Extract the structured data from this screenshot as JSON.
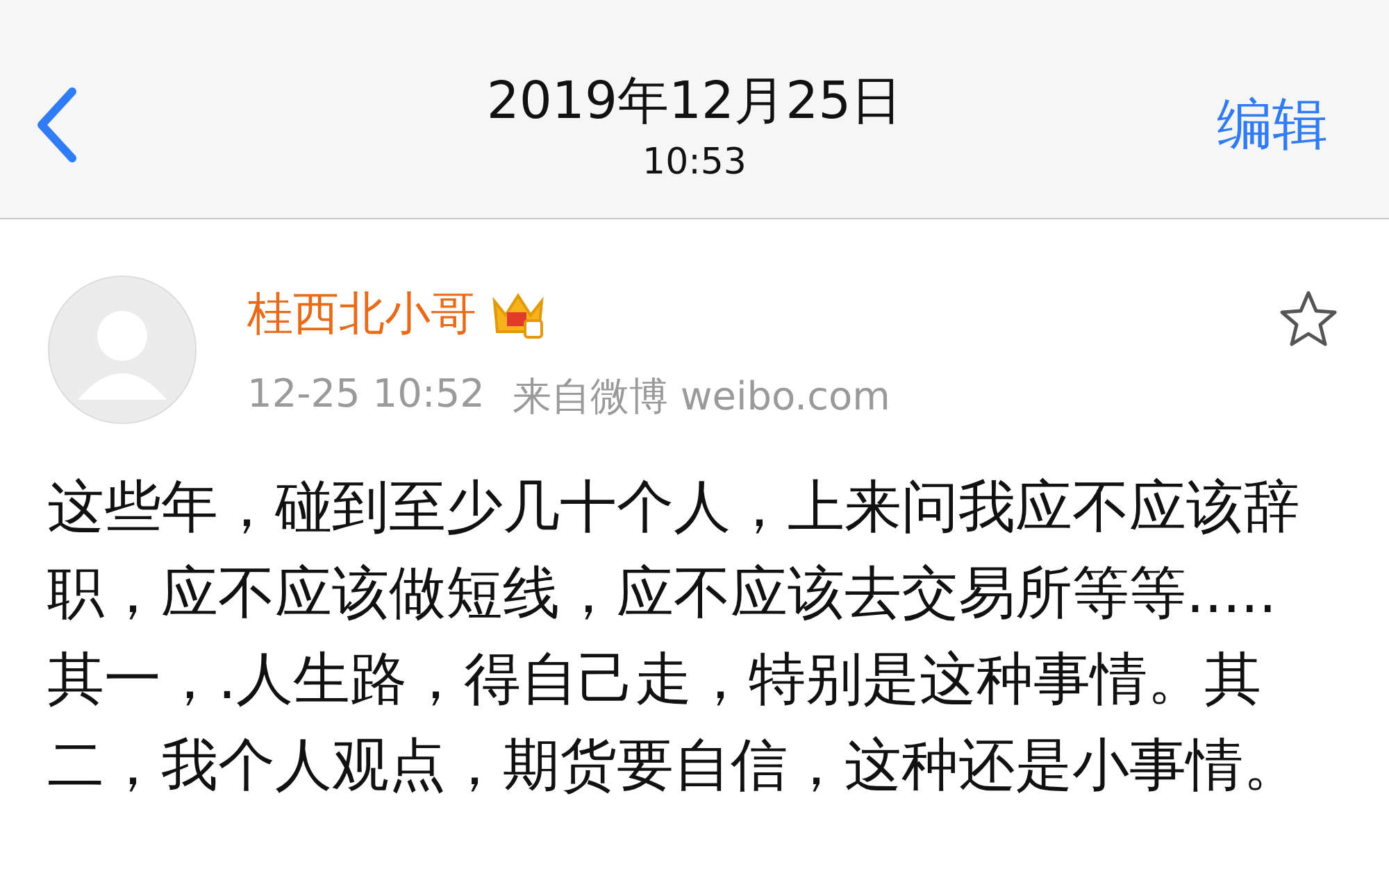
{
  "nav_bar": {
    "date": "2019年12月25日",
    "time": "10:53",
    "edit": "编辑"
  },
  "post": {
    "author": "桂西北小哥",
    "timestamp": "12-25 10:52",
    "source": "来自微博 weibo.com",
    "starred": false,
    "text": "这些年，碰到至少几十个人，上来问我应不应该辞职，应不应该做短线，应不应该去交易所等等.....其一，.人生路，得自己走，特别是这种事情。其二，我个人观点，期货要自信，这种还是小事情。"
  }
}
